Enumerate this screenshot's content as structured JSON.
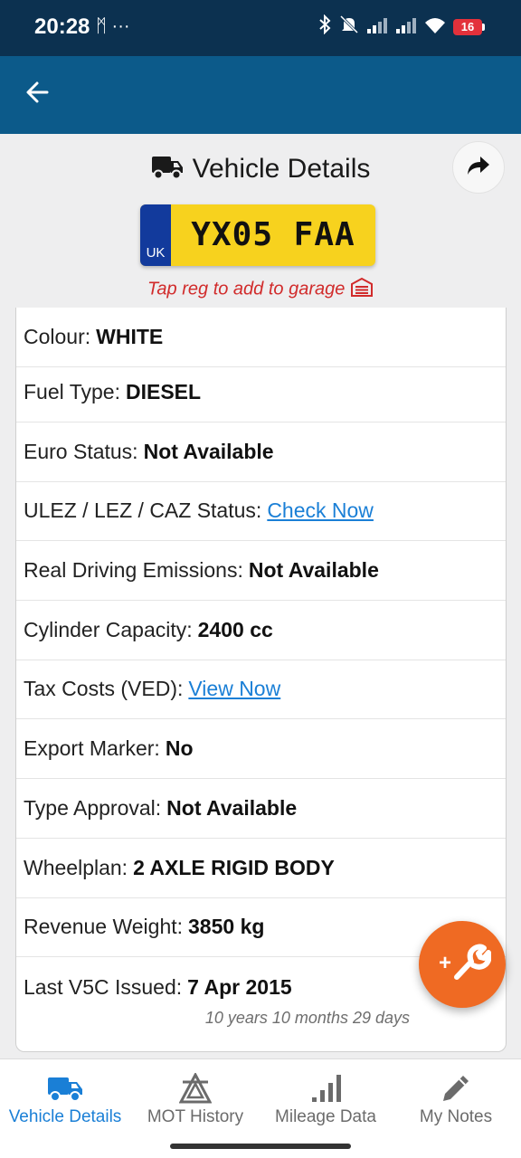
{
  "status_bar": {
    "time": "20:28",
    "left_icons": "ᛗ ···",
    "battery_level": "16"
  },
  "header": {
    "title": "Vehicle Details",
    "back_icon": "arrow-left-icon",
    "share_icon": "share-icon"
  },
  "plate": {
    "country": "UK",
    "registration": "YX05 FAA",
    "hint": "Tap reg to add to garage"
  },
  "details": [
    {
      "label": "Colour:",
      "value": "WHITE"
    },
    {
      "label": "Fuel Type:",
      "value": "DIESEL"
    },
    {
      "label": "Euro Status:",
      "value": "Not Available"
    },
    {
      "label": "ULEZ / LEZ / CAZ Status:",
      "link": "Check Now"
    },
    {
      "label": "Real Driving Emissions:",
      "value": "Not Available"
    },
    {
      "label": "Cylinder Capacity:",
      "value": "2400 cc"
    },
    {
      "label": "Tax Costs (VED):",
      "link": "View Now"
    },
    {
      "label": "Export Marker:",
      "value": "No"
    },
    {
      "label": "Type Approval:",
      "value": "Not Available"
    },
    {
      "label": "Wheelplan:",
      "value": "2 AXLE RIGID BODY"
    },
    {
      "label": "Revenue Weight:",
      "value": "3850 kg"
    },
    {
      "label": "Last V5C Issued:",
      "value": "7 Apr 2015",
      "note": "10 years 10 months 29 days"
    }
  ],
  "bottom_nav": [
    {
      "label": "Vehicle Details",
      "icon": "truck-icon",
      "active": true
    },
    {
      "label": "MOT History",
      "icon": "mot-triangle-icon",
      "active": false
    },
    {
      "label": "Mileage Data",
      "icon": "bar-signal-icon",
      "active": false
    },
    {
      "label": "My Notes",
      "icon": "pencil-icon",
      "active": false
    }
  ],
  "colors": {
    "status_bar": "#0c3150",
    "app_bar": "#0c5a8a",
    "accent_link": "#1a7fd6",
    "fab": "#ef6a23",
    "plate_yellow": "#f7d21e",
    "hint_red": "#d12b2b"
  }
}
